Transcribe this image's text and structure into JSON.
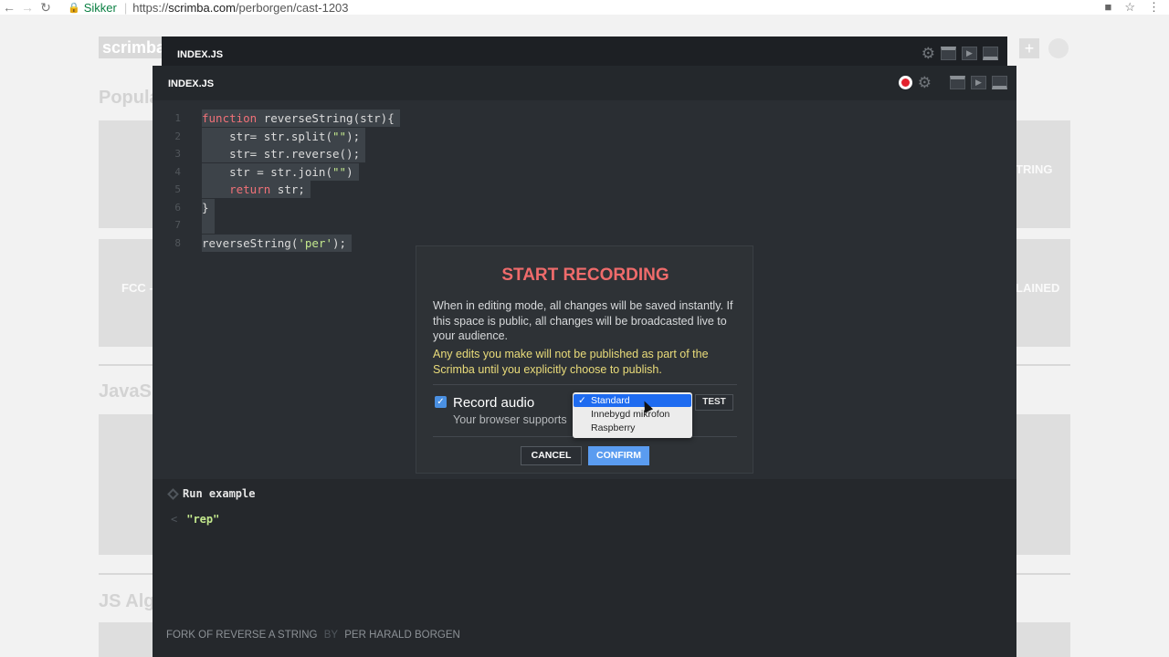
{
  "browser": {
    "secure_label": "Sikker",
    "url_prefix": "https://",
    "url_host": "scrimba.com",
    "url_path": "/perborgen/cast-1203"
  },
  "site": {
    "logo": "scrimba",
    "headings": [
      "Popula",
      "JavaS",
      "JS Alg"
    ],
    "card_texts": [
      "TRING",
      "FCC -",
      "LAINED"
    ]
  },
  "editor_back": {
    "title": "INDEX.JS"
  },
  "editor": {
    "title": "INDEX.JS",
    "code_lines": [
      {
        "n": "1",
        "parts": [
          {
            "t": "function",
            "c": "kw"
          },
          {
            "t": " reverseString(str){",
            "c": ""
          }
        ],
        "sel": true
      },
      {
        "n": "2",
        "parts": [
          {
            "t": "    str= str.split(",
            "c": ""
          },
          {
            "t": "\"\"",
            "c": "str"
          },
          {
            "t": ");",
            "c": ""
          }
        ],
        "sel": true
      },
      {
        "n": "3",
        "parts": [
          {
            "t": "    str= str.reverse();",
            "c": ""
          }
        ],
        "sel": true
      },
      {
        "n": "4",
        "parts": [
          {
            "t": "    str = str.join(",
            "c": ""
          },
          {
            "t": "\"\"",
            "c": "str"
          },
          {
            "t": ")",
            "c": ""
          }
        ],
        "sel": true
      },
      {
        "n": "5",
        "parts": [
          {
            "t": "    ",
            "c": ""
          },
          {
            "t": "return",
            "c": "kw"
          },
          {
            "t": " str;",
            "c": ""
          }
        ],
        "sel": true
      },
      {
        "n": "6",
        "parts": [
          {
            "t": "}",
            "c": ""
          }
        ],
        "sel": true
      },
      {
        "n": "7",
        "parts": [
          {
            "t": " ",
            "c": ""
          }
        ],
        "sel": true
      },
      {
        "n": "8",
        "parts": [
          {
            "t": "reverseString(",
            "c": ""
          },
          {
            "t": "'per'",
            "c": "str"
          },
          {
            "t": ");",
            "c": ""
          }
        ],
        "sel": true
      }
    ],
    "run_label": "Run example",
    "output_value": "\"rep\"",
    "footer_fork": "FORK OF REVERSE A STRING",
    "footer_by": "BY",
    "footer_author": "PER HARALD BORGEN"
  },
  "modal": {
    "title": "START RECORDING",
    "text": "When in editing mode, all changes will be saved instantly. If this space is public, all changes will be broadcasted live to your audience.",
    "warning": "Any edits you make will not be published as part of the Scrimba until you explicitly choose to publish.",
    "record_label": "Record audio",
    "record_sub": "Your browser supports",
    "test_label": "TEST",
    "cancel_label": "CANCEL",
    "confirm_label": "CONFIRM",
    "dropdown_options": [
      "Standard",
      "Innebygd mikrofon",
      "Raspberry"
    ],
    "dropdown_selected": "Standard"
  },
  "colors": {
    "accent_red": "#ef6b6b",
    "warning_yellow": "#eadc7a",
    "confirm_blue": "#5a9cf0",
    "editor_bg": "#2a2e33"
  }
}
